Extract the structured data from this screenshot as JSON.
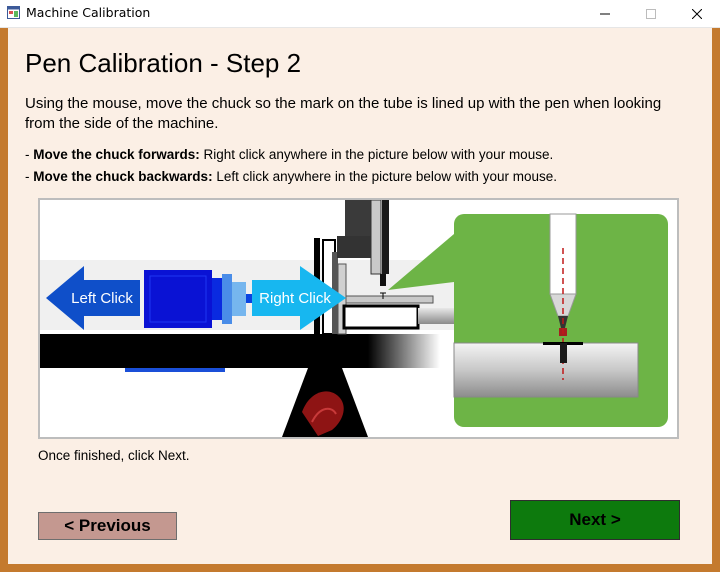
{
  "window": {
    "title": "Machine Calibration",
    "app_icon": "form-icon",
    "controls": [
      "minimize-icon",
      "maximize-icon",
      "close-icon"
    ]
  },
  "page": {
    "heading": "Pen Calibration - Step 2",
    "intro": "Using the mouse, move the chuck so the mark on the tube is lined up with the pen when looking from the side of the machine.",
    "bullets": [
      {
        "prefix": "- ",
        "bold": "Move the chuck forwards:",
        "text": " Right click anywhere in the picture below with your mouse."
      },
      {
        "prefix": "- ",
        "bold": "Move the chuck backwards:",
        "text": " Left click anywhere in the picture below with your mouse."
      }
    ],
    "footer_hint": "Once finished, click Next."
  },
  "illustration": {
    "left_arrow_label": "Left Click",
    "right_arrow_label": "Right Click"
  },
  "buttons": {
    "previous": "< Previous",
    "next": "Next >"
  },
  "colors": {
    "frame": "#c47a2e",
    "client_bg": "#fbefe5",
    "previous_bg": "#c49890",
    "next_bg": "#0d7a0d",
    "arrow_left": "#0f4fc9",
    "arrow_right": "#17b7f0",
    "zoom_bg": "#6db446"
  }
}
